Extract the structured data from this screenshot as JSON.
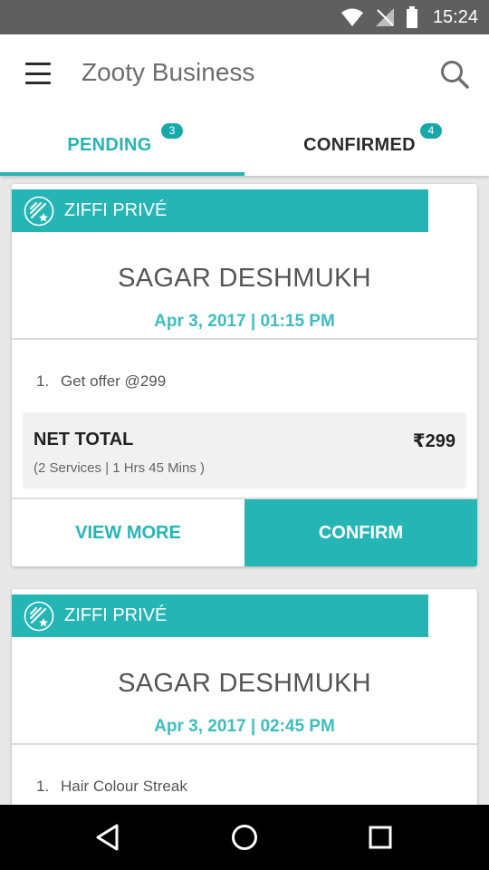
{
  "status_bar": {
    "time": "15:24"
  },
  "app_bar": {
    "title": "Zooty Business"
  },
  "tabs": [
    {
      "label": "PENDING",
      "badge": "3",
      "selected": true
    },
    {
      "label": "CONFIRMED",
      "badge": "4",
      "selected": false
    }
  ],
  "bookings": [
    {
      "brand": "ZIFFI PRIVÉ",
      "customer": "SAGAR DESHMUKH",
      "datetime": "Apr 3, 2017 | 01:15 PM",
      "services": [
        {
          "num": "1.",
          "name": "Get offer @299"
        }
      ],
      "total_label": "NET TOTAL",
      "total_amount": "₹299",
      "total_details": "(2 Services | 1 Hrs 45 Mins )",
      "view_more_label": "VIEW MORE",
      "confirm_label": "CONFIRM"
    },
    {
      "brand": "ZIFFI PRIVÉ",
      "customer": "SAGAR DESHMUKH",
      "datetime": "Apr 3, 2017 | 02:45 PM",
      "services": [
        {
          "num": "1.",
          "name": "Hair Colour Streak"
        }
      ]
    }
  ],
  "colors": {
    "accent": "#26b5b5",
    "status_bar": "#5f5f5f",
    "nav_bar": "#000000"
  }
}
